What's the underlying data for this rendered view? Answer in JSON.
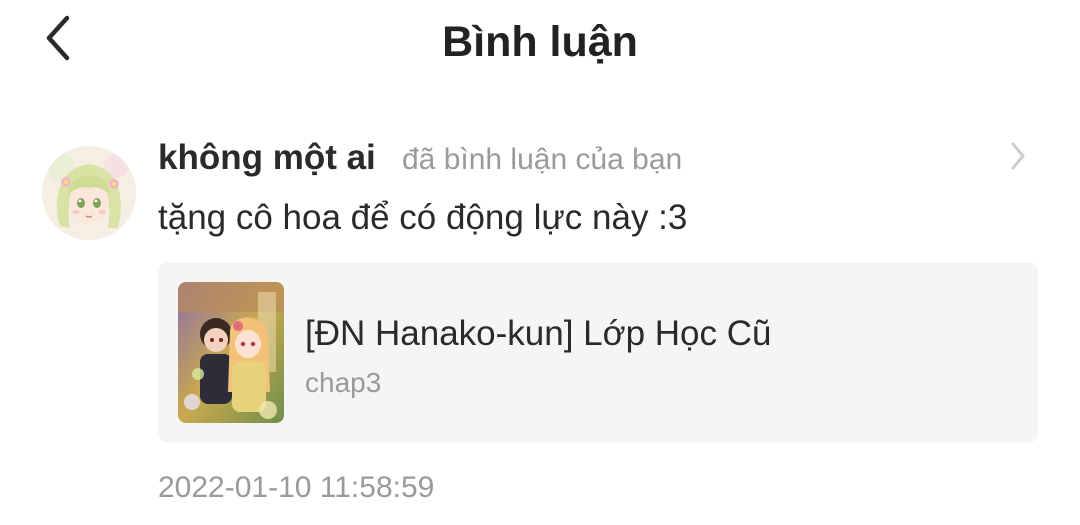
{
  "header": {
    "title": "Bình luận",
    "back_icon": "chevron-left-icon"
  },
  "comment": {
    "user_name": "không một ai",
    "action": "đã bình luận của bạn",
    "text": "tặng cô hoa để có động lực này :3",
    "timestamp": "2022-01-10 11:58:59",
    "avatar": "avatar-anime-girl",
    "arrow_icon": "chevron-right-icon"
  },
  "story": {
    "title": "[ĐN Hanako-kun] Lớp Học Cũ",
    "chapter": "chap3",
    "cover": "story-cover-image"
  },
  "colors": {
    "text_primary": "#2a2a2a",
    "text_secondary": "#9a9a9a",
    "card_bg": "#f5f5f5"
  }
}
